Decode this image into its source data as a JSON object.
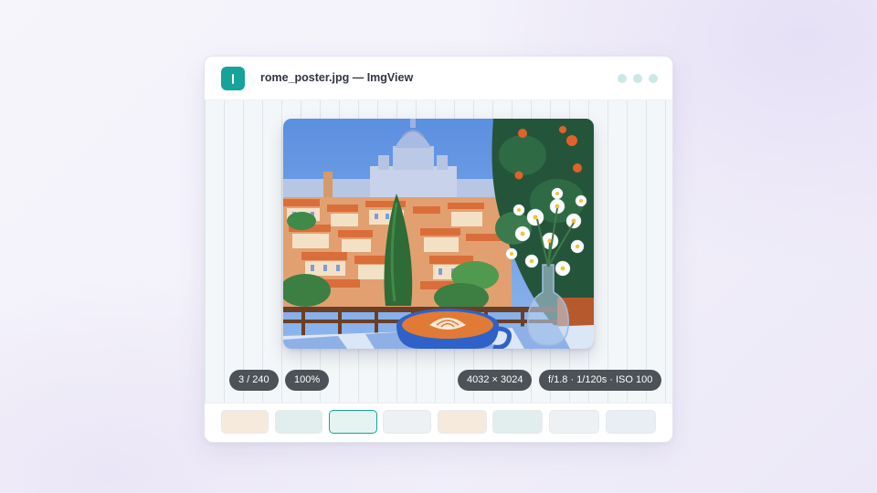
{
  "window": {
    "title": "rome_poster.jpg — ImgView",
    "app_icon": "image-viewer-app-icon",
    "accent_color": "#16a39a"
  },
  "photo": {
    "alt": "Illustrated poster of Rome rooftops with St. Peter's dome, a latte cup and daisies in a glass vase"
  },
  "status": {
    "position": "3 / 240",
    "zoom": "100%",
    "dimensions": "4032 × 3024",
    "exposure": "f/1.8 · 1/120s · ISO 100"
  },
  "filmstrip": {
    "thumbnails": [
      {
        "color": "#f5eadc",
        "selected": false
      },
      {
        "color": "#e2eeed",
        "selected": false
      },
      {
        "color": "#e5f4f1",
        "selected": true
      },
      {
        "color": "#edf1f4",
        "selected": false
      },
      {
        "color": "#f5eadc",
        "selected": false
      },
      {
        "color": "#e2eeed",
        "selected": false
      },
      {
        "color": "#edf1f4",
        "selected": false
      },
      {
        "color": "#e8eef3",
        "selected": false
      }
    ]
  }
}
